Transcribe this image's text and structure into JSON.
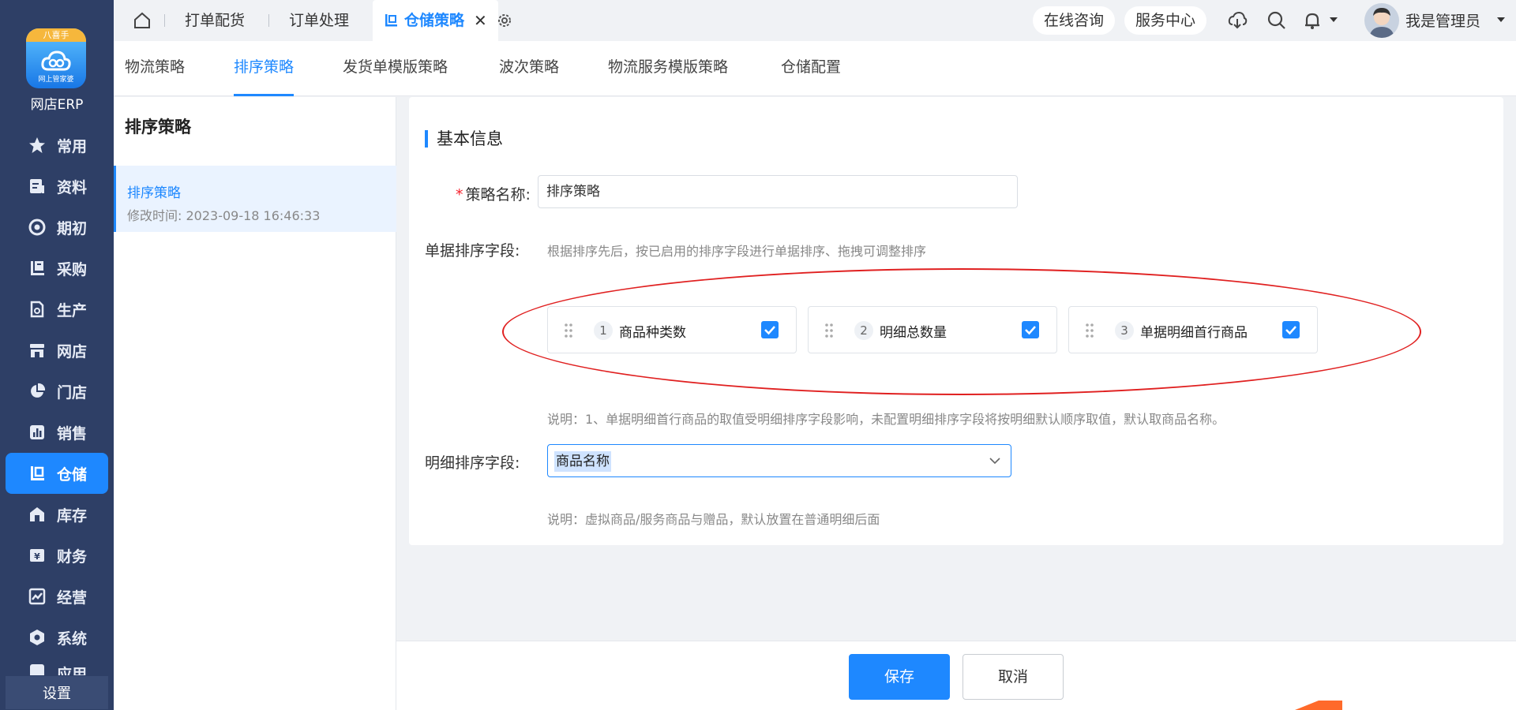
{
  "brand": {
    "tag": "八喜手",
    "sub": "网上管家婆",
    "name": "网店ERP"
  },
  "nav": {
    "items": [
      {
        "label": "常用",
        "icon": "star-icon"
      },
      {
        "label": "资料",
        "icon": "document-icon"
      },
      {
        "label": "期初",
        "icon": "target-icon"
      },
      {
        "label": "采购",
        "icon": "purchase-icon"
      },
      {
        "label": "生产",
        "icon": "production-icon"
      },
      {
        "label": "网店",
        "icon": "shop-icon"
      },
      {
        "label": "门店",
        "icon": "pie-icon"
      },
      {
        "label": "销售",
        "icon": "chart-icon"
      },
      {
        "label": "仓储",
        "icon": "warehouse-icon",
        "active": true
      },
      {
        "label": "库存",
        "icon": "house-icon"
      },
      {
        "label": "财务",
        "icon": "finance-icon"
      },
      {
        "label": "经营",
        "icon": "trend-icon"
      },
      {
        "label": "系统",
        "icon": "hexagon-icon"
      },
      {
        "label": "应用",
        "icon": "app-icon"
      }
    ],
    "settings_label": "设置"
  },
  "topbar": {
    "tabs": [
      "打单配货",
      "订单处理",
      "仓储策略"
    ],
    "active_tab": "仓储策略",
    "close_glyph": "✕",
    "consult": "在线咨询",
    "service": "服务中心",
    "username": "我是管理员"
  },
  "subtabs": [
    "物流策略",
    "排序策略",
    "发货单模版策略",
    "波次策略",
    "物流服务模版策略",
    "仓储配置"
  ],
  "left_panel": {
    "title": "排序策略",
    "item_name": "排序策略",
    "item_time": "修改时间: 2023-09-18 16:46:33"
  },
  "form": {
    "section_title": "基本信息",
    "name_label": "策略名称:",
    "name_required": "*",
    "name_value": "排序策略",
    "order_label": "单据排序字段:",
    "order_hint": "根据排序先后，按已启用的排序字段进行单据排序、拖拽可调整排序",
    "sort_fields": [
      {
        "index": "1",
        "label": "商品种类数",
        "checked": true
      },
      {
        "index": "2",
        "label": "明细总数量",
        "checked": true
      },
      {
        "index": "3",
        "label": "单据明细首行商品",
        "checked": true
      }
    ],
    "order_note": "说明：1、单据明细首行商品的取值受明细排序字段影响，未配置明细排序字段将按明细默认顺序取值，默认取商品名称。",
    "detail_label": "明细排序字段:",
    "detail_value": "商品名称",
    "detail_note": "说明：虚拟商品/服务商品与赠品，默认放置在普通明细后面"
  },
  "footer": {
    "save": "保存",
    "cancel": "取消"
  },
  "colors": {
    "accent": "#1e88ff",
    "nav_bg": "#2e3f66",
    "annotation": "#e02020"
  }
}
